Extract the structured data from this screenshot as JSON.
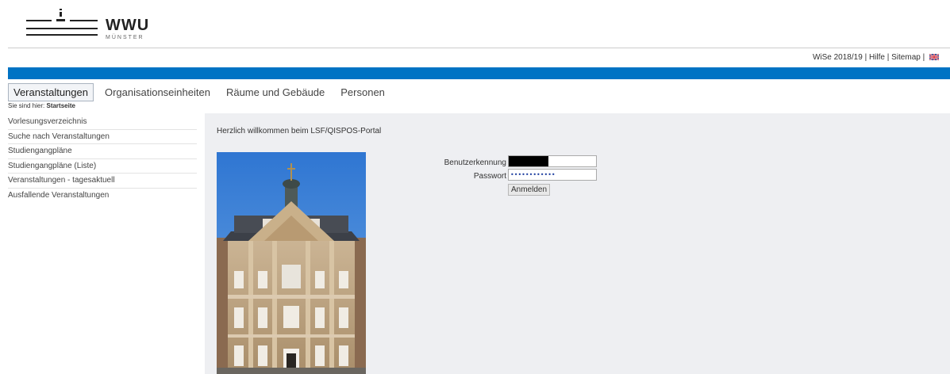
{
  "logo": {
    "name": "WWU",
    "subtitle": "MÜNSTER"
  },
  "toplinks": {
    "semester": "WiSe 2018/19",
    "sep1": "|",
    "help": "Hilfe",
    "sep2": "|",
    "sitemap": "Sitemap",
    "sep3": "|",
    "language_icon": "uk-flag-icon"
  },
  "colors": {
    "brand_blue": "#0073c4",
    "content_bg": "#eeeff2"
  },
  "nav": {
    "tabs": [
      {
        "label": "Veranstaltungen",
        "active": true
      },
      {
        "label": "Organisationseinheiten",
        "active": false
      },
      {
        "label": "Räume und Gebäude",
        "active": false
      },
      {
        "label": "Personen",
        "active": false
      }
    ]
  },
  "breadcrumb": {
    "prefix": "Sie sind hier:",
    "current": "Startseite"
  },
  "sidebar": {
    "items": [
      {
        "label": "Vorlesungsverzeichnis"
      },
      {
        "label": "Suche nach Veranstaltungen"
      },
      {
        "label": "Studiengangpläne"
      },
      {
        "label": "Studiengangpläne (Liste)"
      },
      {
        "label": "Veranstaltungen - tagesaktuell"
      },
      {
        "label": "Ausfallende Veranstaltungen"
      }
    ]
  },
  "main": {
    "welcome": "Herzlich willkommen beim LSF/QISPOS-Portal"
  },
  "login": {
    "username_label": "Benutzerkennung",
    "username_value": "",
    "password_label": "Passwort",
    "password_value": "••••••••••••",
    "submit_label": "Anmelden"
  }
}
